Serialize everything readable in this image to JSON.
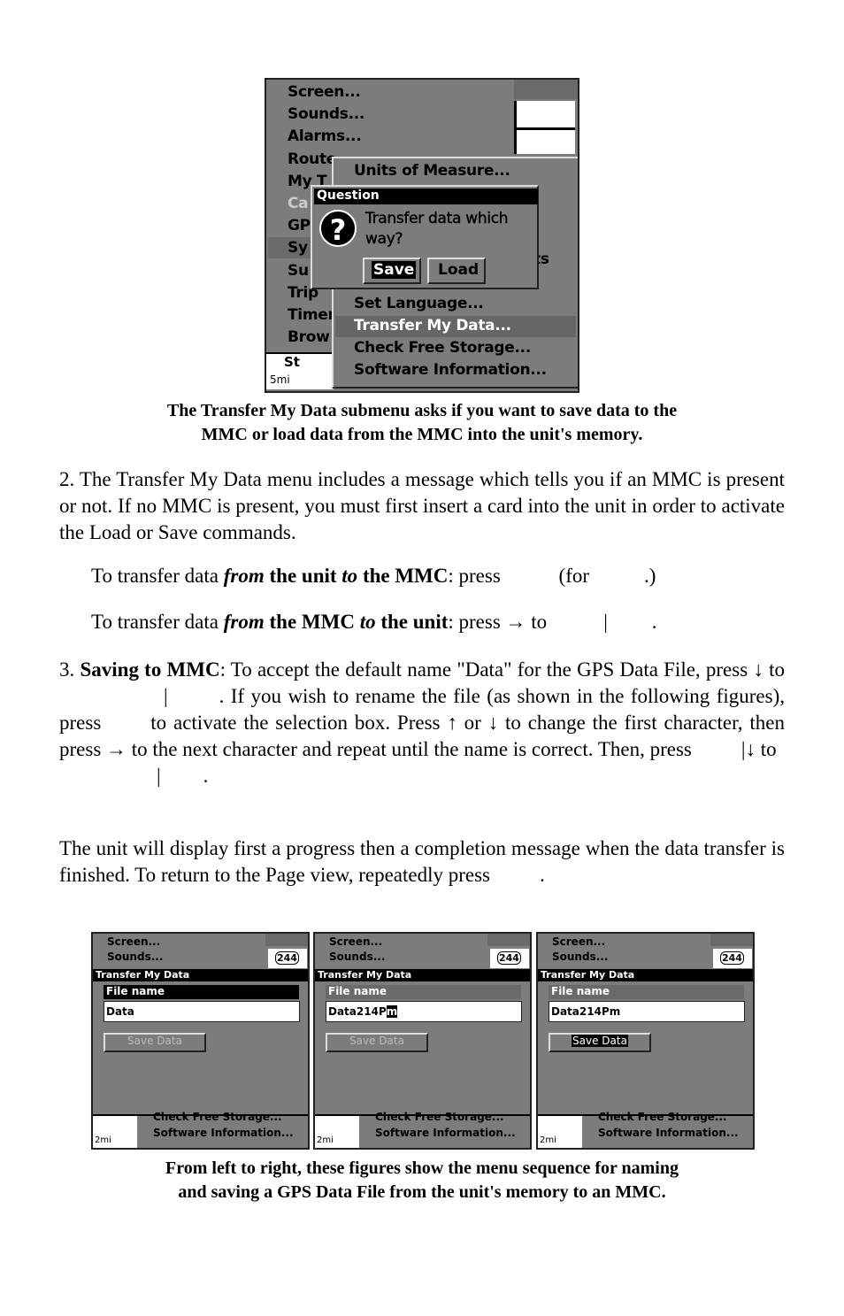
{
  "top_screen": {
    "menu": [
      "Screen...",
      "Sounds...",
      "Alarms...",
      "Route",
      "My T",
      "Ca",
      "GP",
      "Sy",
      "Su",
      "Trip",
      "Timer",
      "Brow"
    ],
    "submenu": [
      "Units of Measure...",
      "Set Language...",
      "Transfer My Data...",
      "Check Free Storage...",
      "Software Information..."
    ],
    "partial_text": "ts",
    "scale": "5mi",
    "map_label": "St",
    "dialog": {
      "title": "Question",
      "message_line1": "Transfer data which",
      "message_line2": "way?",
      "save": "Save",
      "load": "Load",
      "icon": "question-icon"
    }
  },
  "caption1": [
    "The Transfer My Data submenu asks if you want to save data to the",
    "MMC or load data from the MMC into the unit's memory."
  ],
  "para2": "2. The Transfer My Data menu includes a message which tells you if an MMC is present or not. If no MMC is present, you must first insert a card into the unit in order to activate the Load or Save commands.",
  "line_save": {
    "a": "To transfer data ",
    "b": "from",
    "c": " the unit ",
    "d": "to",
    "e": " the MMC",
    "f": ": press ",
    "g": "(for",
    "h": ".)"
  },
  "line_load": {
    "a": "To transfer data ",
    "b": "from",
    "c": " the MMC ",
    "d": "to",
    "e": " the unit",
    "f": ": press → to",
    "g": "|",
    "h": "."
  },
  "para3": {
    "num": "3. ",
    "bold": "Saving to MMC",
    "rest1": ": To accept the default name \"Data\" for the GPS Data File, press ↓ to",
    "bar": "|",
    "rest2": ". If you wish to rename the file (as shown in the following figures), press",
    "rest3": "to activate the selection box. Press ↑ or ↓ to change the first character, then press → to the next character and repeat until the name is correct. Then, press",
    "rest4": "|↓ to",
    "rest5": "|",
    "rest6": "."
  },
  "para4": "The unit will display first a progress then a completion message when the data transfer is finished. To return to the Page view, repeatedly press",
  "para4_end": ".",
  "frames": [
    {
      "menu1": "Screen...",
      "menu2": "Sounds...",
      "badge": "244",
      "title": "Transfer My Data",
      "label": "File name",
      "value": "Data",
      "cursor": "",
      "button": "Save Data",
      "button_active": false,
      "bottom1": "Check Free Storage...",
      "bottom2": "Software Information...",
      "scale": "2mi"
    },
    {
      "menu1": "Screen...",
      "menu2": "Sounds...",
      "badge": "244",
      "title": "Transfer My Data",
      "label": "File name",
      "value": "Data214P",
      "cursor": "m",
      "button": "Save Data",
      "button_active": false,
      "bottom1": "Check Free Storage...",
      "bottom2": "Software Information...",
      "scale": "2mi"
    },
    {
      "menu1": "Screen...",
      "menu2": "Sounds...",
      "badge": "244",
      "title": "Transfer My Data",
      "label": "File name",
      "value": "Data214Pm",
      "cursor": "",
      "button": "Save Data",
      "button_active": true,
      "bottom1": "Check Free Storage...",
      "bottom2": "Software Information...",
      "scale": "2mi"
    }
  ],
  "caption2": [
    "From left to right, these figures show the menu sequence for naming",
    "and saving a GPS Data File from the unit's memory to an MMC."
  ]
}
